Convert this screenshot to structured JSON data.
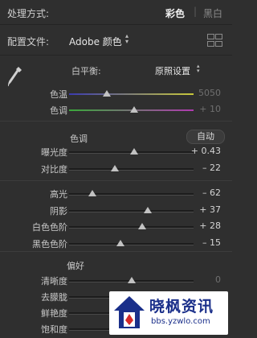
{
  "header": {
    "title": "处理方式:",
    "mode_color": "彩色",
    "divider": "|",
    "mode_bw": "黑白"
  },
  "profile": {
    "label": "配置文件:",
    "value": "Adobe 颜色",
    "chevron": "⌃⌄"
  },
  "white_balance": {
    "label": "白平衡:",
    "value": "原照设置",
    "chevron": "⌃⌄",
    "sliders": [
      {
        "name": "色温",
        "value": "5050",
        "position": 0.3,
        "dim": true,
        "track": "temp"
      },
      {
        "name": "色调",
        "value": "+ 10",
        "position": 0.52,
        "dim": true,
        "track": "tint"
      }
    ]
  },
  "tone": {
    "title": "色调",
    "auto_label": "自动",
    "sliders": [
      {
        "name": "曝光度",
        "value": "+ 0.43",
        "position": 0.52
      },
      {
        "name": "对比度",
        "value": "– 22",
        "position": 0.37
      }
    ]
  },
  "tone2": {
    "sliders": [
      {
        "name": "高光",
        "value": "– 62",
        "position": 0.19
      },
      {
        "name": "阴影",
        "value": "+ 37",
        "position": 0.63
      },
      {
        "name": "白色色阶",
        "value": "+ 28",
        "position": 0.59
      },
      {
        "name": "黑色色阶",
        "value": "– 15",
        "position": 0.41
      }
    ]
  },
  "presence": {
    "title": "偏好",
    "sliders": [
      {
        "name": "清晰度",
        "value": "0",
        "position": 0.5,
        "dim": true
      },
      {
        "name": "去朦胧",
        "value": "",
        "position": 0.5
      },
      {
        "name": "鲜艳度",
        "value": "",
        "position": 0.5
      },
      {
        "name": "饱和度",
        "value": "",
        "position": 0.5
      }
    ]
  },
  "watermark": {
    "title": "晓枫资讯",
    "url": "bbs.yzwlo.com"
  },
  "colors": {
    "background": "#2f2f2f",
    "temp_track_start": "#3a3ab0",
    "temp_track_end": "#c8c83a",
    "tint_track_start": "#3aa83a",
    "tint_track_end": "#b03ab0",
    "watermark_blue": "#1a2f8a",
    "watermark_red": "#d42a2a"
  }
}
